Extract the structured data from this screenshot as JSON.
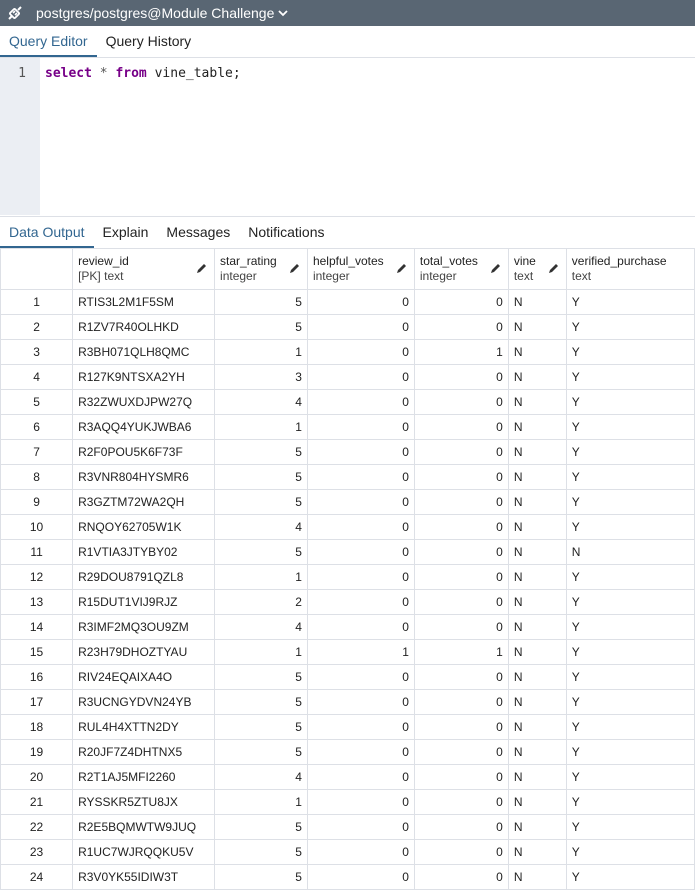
{
  "window": {
    "title": "postgres/postgres@Module Challenge",
    "icons": [
      "connection-plug-icon",
      "chevron-down-icon"
    ]
  },
  "editor_tabs": [
    "Query Editor",
    "Query History"
  ],
  "editor": {
    "line_number": "1",
    "query": {
      "kw1": "select",
      "star": "*",
      "kw2": "from",
      "table": "vine_table;"
    }
  },
  "output_tabs": [
    "Data Output",
    "Explain",
    "Messages",
    "Notifications"
  ],
  "grid": {
    "columns": [
      {
        "name": "review_id",
        "type": "[PK] text"
      },
      {
        "name": "star_rating",
        "type": "integer"
      },
      {
        "name": "helpful_votes",
        "type": "integer"
      },
      {
        "name": "total_votes",
        "type": "integer"
      },
      {
        "name": "vine",
        "type": "text"
      },
      {
        "name": "verified_purchase",
        "type": "text"
      }
    ],
    "rows": [
      [
        "1",
        "RTIS3L2M1F5SM",
        "5",
        "0",
        "0",
        "N",
        "Y"
      ],
      [
        "2",
        "R1ZV7R40OLHKD",
        "5",
        "0",
        "0",
        "N",
        "Y"
      ],
      [
        "3",
        "R3BH071QLH8QMC",
        "1",
        "0",
        "1",
        "N",
        "Y"
      ],
      [
        "4",
        "R127K9NTSXA2YH",
        "3",
        "0",
        "0",
        "N",
        "Y"
      ],
      [
        "5",
        "R32ZWUXDJPW27Q",
        "4",
        "0",
        "0",
        "N",
        "Y"
      ],
      [
        "6",
        "R3AQQ4YUKJWBA6",
        "1",
        "0",
        "0",
        "N",
        "Y"
      ],
      [
        "7",
        "R2F0POU5K6F73F",
        "5",
        "0",
        "0",
        "N",
        "Y"
      ],
      [
        "8",
        "R3VNR804HYSMR6",
        "5",
        "0",
        "0",
        "N",
        "Y"
      ],
      [
        "9",
        "R3GZTM72WA2QH",
        "5",
        "0",
        "0",
        "N",
        "Y"
      ],
      [
        "10",
        "RNQOY62705W1K",
        "4",
        "0",
        "0",
        "N",
        "Y"
      ],
      [
        "11",
        "R1VTIA3JTYBY02",
        "5",
        "0",
        "0",
        "N",
        "N"
      ],
      [
        "12",
        "R29DOU8791QZL8",
        "1",
        "0",
        "0",
        "N",
        "Y"
      ],
      [
        "13",
        "R15DUT1VIJ9RJZ",
        "2",
        "0",
        "0",
        "N",
        "Y"
      ],
      [
        "14",
        "R3IMF2MQ3OU9ZM",
        "4",
        "0",
        "0",
        "N",
        "Y"
      ],
      [
        "15",
        "R23H79DHOZTYAU",
        "1",
        "1",
        "1",
        "N",
        "Y"
      ],
      [
        "16",
        "RIV24EQAIXA4O",
        "5",
        "0",
        "0",
        "N",
        "Y"
      ],
      [
        "17",
        "R3UCNGYDVN24YB",
        "5",
        "0",
        "0",
        "N",
        "Y"
      ],
      [
        "18",
        "RUL4H4XTTN2DY",
        "5",
        "0",
        "0",
        "N",
        "Y"
      ],
      [
        "19",
        "R20JF7Z4DHTNX5",
        "5",
        "0",
        "0",
        "N",
        "Y"
      ],
      [
        "20",
        "R2T1AJ5MFI2260",
        "4",
        "0",
        "0",
        "N",
        "Y"
      ],
      [
        "21",
        "RYSSKR5ZTU8JX",
        "1",
        "0",
        "0",
        "N",
        "Y"
      ],
      [
        "22",
        "R2E5BQMWTW9JUQ",
        "5",
        "0",
        "0",
        "N",
        "Y"
      ],
      [
        "23",
        "R1UC7WJRQQKU5V",
        "5",
        "0",
        "0",
        "N",
        "Y"
      ],
      [
        "24",
        "R3V0YK55IDIW3T",
        "5",
        "0",
        "0",
        "N",
        "Y"
      ]
    ]
  }
}
